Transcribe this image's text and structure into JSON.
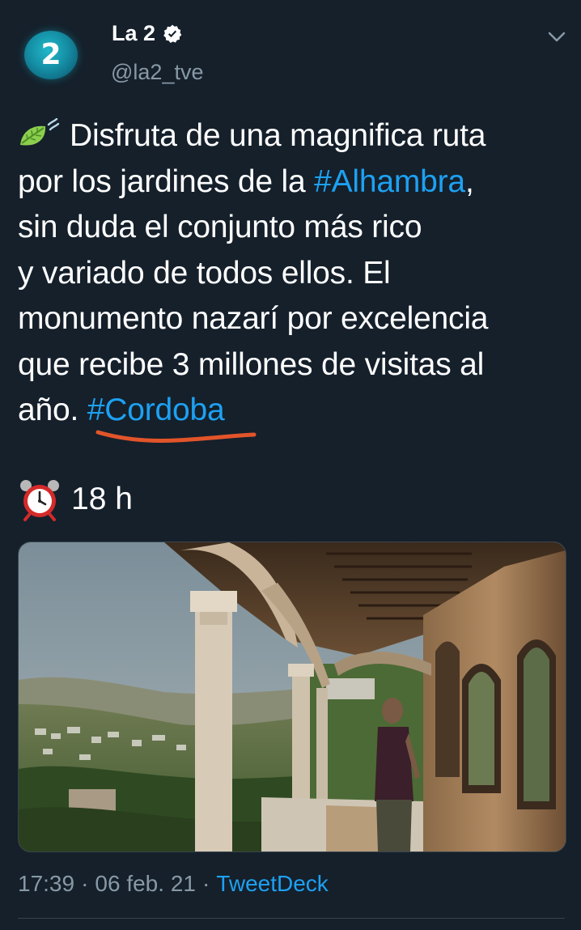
{
  "account": {
    "avatar_text": "2",
    "display_name": "La 2",
    "handle": "@la2_tve",
    "verified": true
  },
  "tweet": {
    "lines": [
      {
        "pre": "Disfruta de una magnifica ruta"
      },
      {
        "pre": "por los jardines de la ",
        "hashtag": "#Alhambra",
        "post": ","
      },
      {
        "pre": "sin duda el conjunto más rico"
      },
      {
        "pre": "y variado de todos ellos. El"
      },
      {
        "pre": "monumento nazarí por excelencia"
      },
      {
        "pre": "que recibe 3 millones de visitas al"
      },
      {
        "pre": "año. ",
        "hashtag": "#Cordoba"
      }
    ],
    "leading_emoji": "leaf-fluttering-in-wind-icon",
    "time_emoji": "alarm-clock-icon",
    "time_text": "18 h"
  },
  "footer": {
    "time": "17:39",
    "separator": "·",
    "date": "06 feb. 21",
    "source": "TweetDeck"
  },
  "colors": {
    "background": "#15202b",
    "text": "#ffffff",
    "muted": "#8899a6",
    "link": "#1da1f2",
    "annotation_underline": "#e2542a"
  }
}
